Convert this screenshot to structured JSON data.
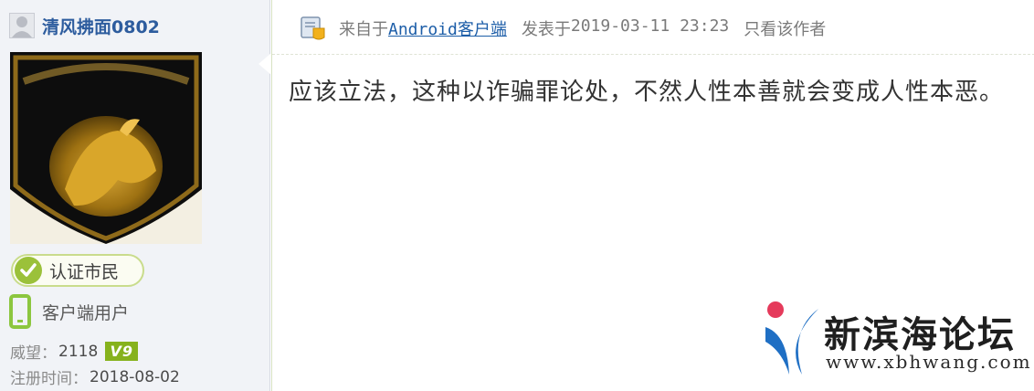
{
  "user": {
    "name": "清风拂面0802",
    "avatar_icon": "lamborghini-logo",
    "badge": "认证市民",
    "client_type": "客户端用户",
    "weiwang_label": "威望：",
    "weiwang_value": "2118",
    "level": "V9",
    "reg_label": "注册时间：",
    "reg_value": "2018-08-02"
  },
  "post": {
    "from_prefix": "来自于",
    "client_link": "Android客户端",
    "posted_label": "发表于",
    "posted_time": "2019-03-11 23:23",
    "only_author": "只看该作者",
    "body": "应该立法，这种以诈骗罪论处，不然人性本善就会变成人性本恶。"
  },
  "watermark": {
    "title": "新滨海论坛",
    "url": "www.xbhwang.com"
  },
  "colors": {
    "username": "#2d5c9e",
    "link": "#1d5ea8",
    "badge_green": "#8cc63f",
    "level_green": "#86b21d"
  }
}
